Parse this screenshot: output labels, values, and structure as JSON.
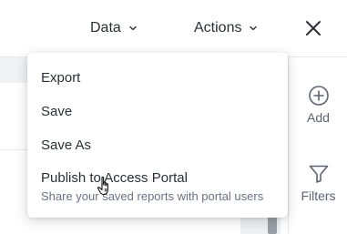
{
  "header": {
    "data_label": "Data",
    "actions_label": "Actions",
    "close_icon": "close-icon",
    "chevron_icon": "chevron-down-icon"
  },
  "sidebar": {
    "add_label": "Add",
    "filters_label": "Filters",
    "add_icon": "plus-circle-icon",
    "filters_icon": "filter-funnel-icon"
  },
  "menu": {
    "items": [
      {
        "label": "Export"
      },
      {
        "label": "Save"
      },
      {
        "label": "Save As"
      },
      {
        "label": "Publish to Access Portal",
        "description": "Share your saved reports with portal users"
      }
    ]
  },
  "colors": {
    "text": "#2b2f36",
    "muted": "#6b7280",
    "border": "#e6e8eb"
  }
}
